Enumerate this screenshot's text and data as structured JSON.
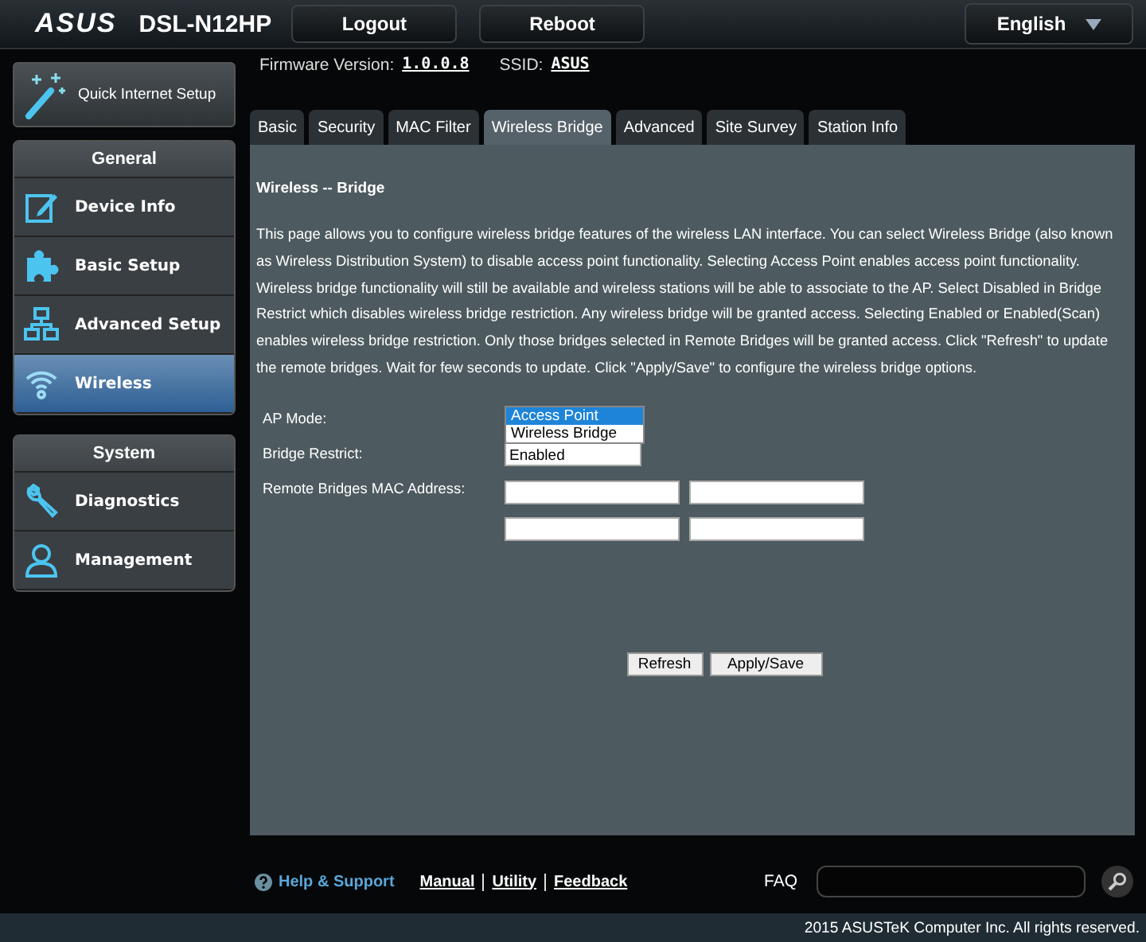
{
  "header": {
    "logo": "ASUS",
    "model": "DSL-N12HP",
    "buttons": [
      "Logout",
      "Reboot"
    ],
    "language": "English"
  },
  "info": {
    "firmware_label": "Firmware Version:",
    "firmware": "1.0.0.8",
    "ssid_label": "SSID:",
    "ssid": "ASUS"
  },
  "quick_setup": "Quick Internet Setup",
  "menu": [
    {
      "title": "General",
      "items": [
        {
          "label": "Device Info",
          "selected": false
        },
        {
          "label": "Basic Setup",
          "selected": false
        },
        {
          "label": "Advanced Setup",
          "selected": false
        },
        {
          "label": "Wireless",
          "selected": true
        }
      ]
    },
    {
      "title": "System",
      "items": [
        {
          "label": "Diagnostics",
          "selected": false
        },
        {
          "label": "Management",
          "selected": false
        }
      ]
    }
  ],
  "tabs": [
    {
      "label": "Basic",
      "selected": false
    },
    {
      "label": "Security",
      "selected": false
    },
    {
      "label": "MAC Filter",
      "selected": false
    },
    {
      "label": "Wireless Bridge",
      "selected": true
    },
    {
      "label": "Advanced",
      "selected": false
    },
    {
      "label": "Site Survey",
      "selected": false
    },
    {
      "label": "Station Info",
      "selected": false
    }
  ],
  "page": {
    "title": "Wireless -- Bridge",
    "description": "This page allows you to configure wireless bridge features of the wireless LAN interface. You can select Wireless Bridge (also known as Wireless Distribution System) to disable access point functionality. Selecting Access Point enables access point functionality. Wireless bridge functionality will still be available and wireless stations will be able to associate to the AP. Select Disabled in Bridge Restrict which disables wireless bridge restriction. Any wireless bridge will be granted access. Selecting Enabled or Enabled(Scan) enables wireless bridge restriction. Only those bridges selected in Remote Bridges will be granted access. Click \"Refresh\" to update the remote bridges. Wait for few seconds to update. Click \"Apply/Save\" to configure the wireless bridge options."
  },
  "form": {
    "ap_mode_label": "AP Mode:",
    "ap_mode_options": [
      {
        "label": "Access Point",
        "selected": true
      },
      {
        "label": "Wireless Bridge",
        "selected": false
      }
    ],
    "bridge_restrict_label": "Bridge Restrict:",
    "bridge_restrict": "Enabled",
    "mac_label": "Remote Bridges MAC Address:"
  },
  "buttons": [
    "Refresh",
    "Apply/Save"
  ],
  "footer": {
    "help": "Help & Support",
    "links": [
      "Manual",
      "Utility",
      "Feedback"
    ],
    "faq": "FAQ",
    "copyright": "2015 ASUSTeK Computer Inc. All rights reserved."
  }
}
